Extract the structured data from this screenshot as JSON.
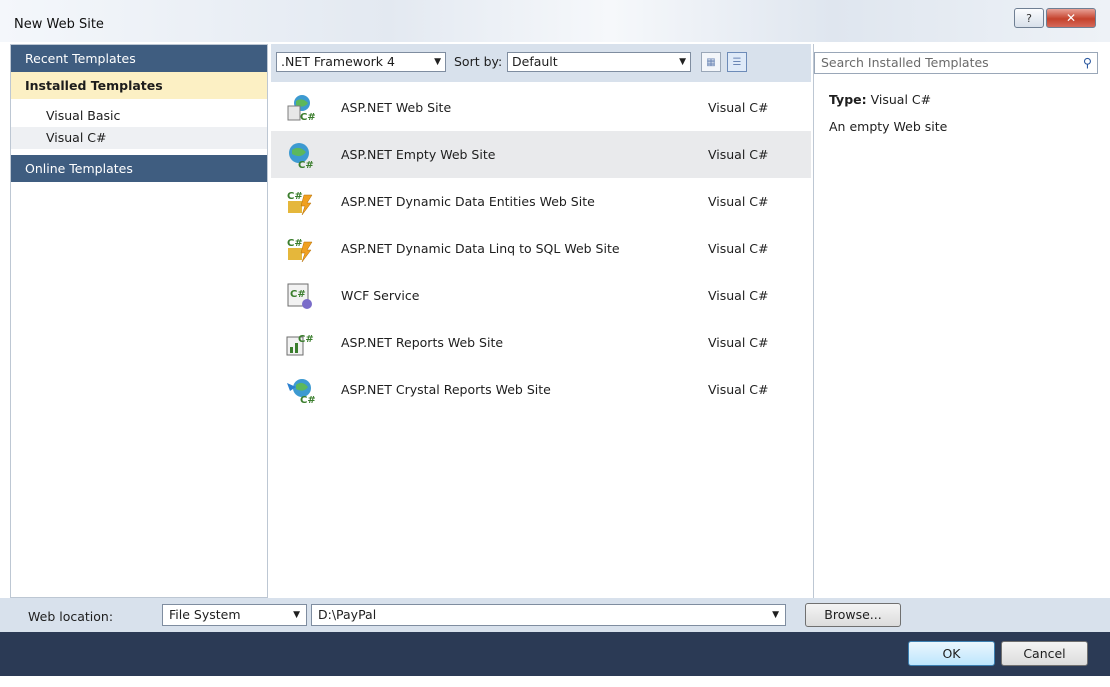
{
  "window": {
    "title": "New Web Site"
  },
  "sidebar": {
    "recent": "Recent Templates",
    "installed": "Installed Templates",
    "items": [
      {
        "label": "Visual Basic"
      },
      {
        "label": "Visual C#"
      }
    ],
    "online": "Online Templates"
  },
  "toolbar": {
    "framework": ".NET Framework 4",
    "sort_label": "Sort by:",
    "sort_value": "Default"
  },
  "templates": [
    {
      "name": "ASP.NET Web Site",
      "lang": "Visual C#",
      "icon": "web-site-icon"
    },
    {
      "name": "ASP.NET Empty Web Site",
      "lang": "Visual C#",
      "icon": "empty-web-site-icon"
    },
    {
      "name": "ASP.NET Dynamic Data Entities Web Site",
      "lang": "Visual C#",
      "icon": "dynamic-data-icon"
    },
    {
      "name": "ASP.NET Dynamic Data Linq to SQL Web Site",
      "lang": "Visual C#",
      "icon": "dynamic-data-icon"
    },
    {
      "name": "WCF Service",
      "lang": "Visual C#",
      "icon": "wcf-service-icon"
    },
    {
      "name": "ASP.NET Reports Web Site",
      "lang": "Visual C#",
      "icon": "reports-icon"
    },
    {
      "name": "ASP.NET Crystal Reports Web Site",
      "lang": "Visual C#",
      "icon": "crystal-reports-icon"
    }
  ],
  "search": {
    "placeholder": "Search Installed Templates"
  },
  "details": {
    "type_label": "Type:",
    "type_value": "Visual C#",
    "description": "An empty Web site"
  },
  "bottom": {
    "location_label": "Web location:",
    "location_value": "File System",
    "path": "D:\\PayPal",
    "browse": "Browse..."
  },
  "footer": {
    "ok": "OK",
    "cancel": "Cancel"
  },
  "colors": {
    "header": "#3f5d80",
    "installed": "#fcf0c4",
    "footer": "#2b3a55",
    "toolbar": "#d8e1ec"
  }
}
